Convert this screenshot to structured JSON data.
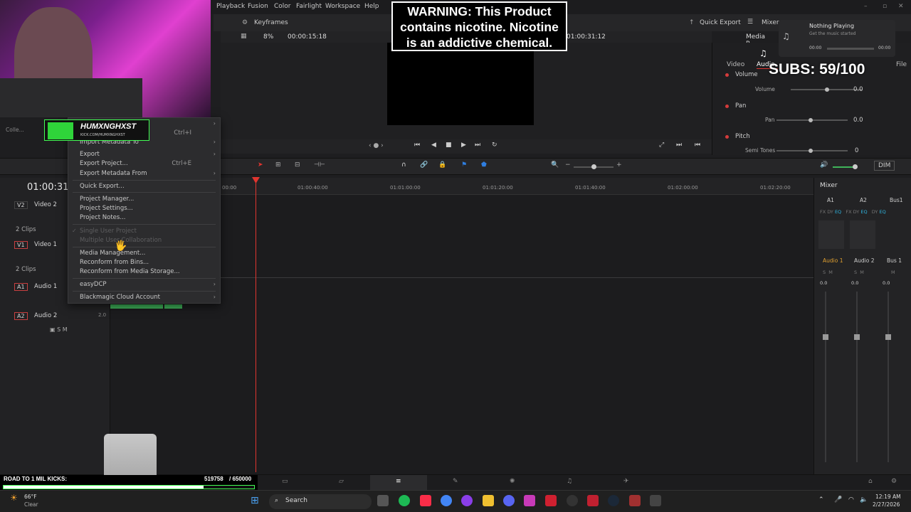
{
  "menubar": {
    "items": [
      "Playback",
      "Fusion",
      "Color",
      "Fairlight",
      "Workspace",
      "Help"
    ]
  },
  "toolbar": {
    "keyframes_label": "Keyframes",
    "quick_export_label": "Quick Export",
    "mixer_label": "Mixer",
    "media_pool_label": "Media P"
  },
  "viewer": {
    "zoom": "8%",
    "duration": "00:00:15:18",
    "timecode": "01:00:31:12"
  },
  "overlay": {
    "warning_lines": [
      "WARNING: This Product",
      "contains nicotine. Nicotine",
      "is an addictive chemical."
    ],
    "subs": "SUBS: 59/100",
    "brand": "HUMXNGHXST",
    "brand_sub": "KICK.COM/HUMXNGHXST",
    "road_label": "ROAD TO 1 MIL KICKS:",
    "road_value": "519758",
    "road_goal": "/ 650000",
    "road_progress": 0.7996
  },
  "now_playing": {
    "title": "Nothing Playing",
    "subtitle": "Get the music started",
    "time_start": "00:00",
    "time_end": "00:00"
  },
  "inspector": {
    "tabs": [
      "Video",
      "Audio",
      "File"
    ],
    "volume_label": "Volume",
    "volume_sub": "Volume",
    "volume_value": "0.0",
    "pan_label": "Pan",
    "pan_sub": "Pan",
    "pan_value": "0.0",
    "pitch_label": "Pitch",
    "pitch_sub": "Semi Tones",
    "pitch_value": "0"
  },
  "context_menu": {
    "items": [
      {
        "label": "Import Metadata To",
        "shortcut": "",
        "submenu": true,
        "disabled": false
      },
      {
        "label": "Export",
        "shortcut": "",
        "submenu": true,
        "disabled": false
      },
      {
        "label": "Export Project...",
        "shortcut": "Ctrl+E",
        "submenu": false,
        "disabled": false
      },
      {
        "label": "Export Metadata From",
        "shortcut": "",
        "submenu": true,
        "disabled": false
      },
      {
        "label": "Quick Export...",
        "shortcut": "",
        "submenu": false,
        "disabled": false
      },
      {
        "label": "Project Manager...",
        "shortcut": "",
        "submenu": false,
        "disabled": false
      },
      {
        "label": "Project Settings...",
        "shortcut": "",
        "submenu": false,
        "disabled": false
      },
      {
        "label": "Project Notes...",
        "shortcut": "",
        "submenu": false,
        "disabled": false
      },
      {
        "label": "Single User Project",
        "shortcut": "",
        "submenu": false,
        "disabled": true
      },
      {
        "label": "Multiple User Collaboration",
        "shortcut": "",
        "submenu": false,
        "disabled": true
      },
      {
        "label": "Media Management...",
        "shortcut": "",
        "submenu": false,
        "disabled": false
      },
      {
        "label": "Reconform from Bins...",
        "shortcut": "",
        "submenu": false,
        "disabled": false
      },
      {
        "label": "Reconform from Media Storage...",
        "shortcut": "",
        "submenu": false,
        "disabled": false
      },
      {
        "label": "easyDCP",
        "shortcut": "",
        "submenu": true,
        "disabled": false
      },
      {
        "label": "Blackmagic Cloud Account",
        "shortcut": "",
        "submenu": true,
        "disabled": false
      }
    ],
    "top_shortcut": "Ctrl+I"
  },
  "timeline": {
    "timecode": "01:00:31",
    "ruler": [
      "00:00",
      "01:00:40:00",
      "01:01:00:00",
      "01:01:20:00",
      "01:01:40:00",
      "01:02:00:00",
      "01:02:20:00"
    ],
    "tracks": [
      {
        "tag": "V2",
        "name": "Video 2",
        "clips": "2 Clips"
      },
      {
        "tag": "V1",
        "name": "Video 1",
        "clips": "2 Clips"
      },
      {
        "tag": "A1",
        "name": "Audio 1",
        "clips": ""
      },
      {
        "tag": "A2",
        "name": "Audio 2",
        "clips": "2.0"
      }
    ],
    "sidebar_label": "Colle..."
  },
  "mixer": {
    "title": "Mixer",
    "channels": [
      "A1",
      "A2",
      "Bus1"
    ],
    "channel_names": [
      "Audio 1",
      "Audio 2",
      "Bus 1"
    ],
    "levels": [
      "0.0",
      "0.0",
      "0.0"
    ],
    "dim_label": "DIM"
  },
  "taskbar": {
    "temp": "66°F",
    "weather": "Clear",
    "search": "Search",
    "time": "12:19 AM",
    "date": "2/27/2026"
  },
  "colors": {
    "accent_red": "#e0352f",
    "brand_green": "#42ff54",
    "clip_green": "#3fb45a"
  }
}
